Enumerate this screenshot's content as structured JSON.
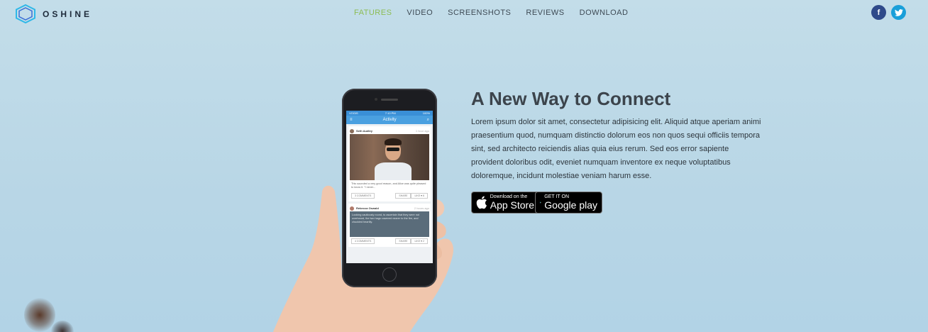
{
  "brand": {
    "name": "OSHINE",
    "accent": "#2fb8e8"
  },
  "nav": {
    "items": [
      "FATURES",
      "VIDEO",
      "SCREENSHOTS",
      "REVIEWS",
      "DOWNLOAD"
    ],
    "active_color": "#8cbc53"
  },
  "social": {
    "facebook": "f",
    "twitter": "t"
  },
  "hero": {
    "title": "A New Way to Connect",
    "description": "Lorem ipsum dolor sit amet, consectetur adipisicing elit. Aliquid atque aperiam animi praesentium quod, numquam distinctio dolorum eos non quos sequi officiis tempora sint, sed architecto reiciendis alias quia eius rerum. Sed eos error sapiente provident doloribus odit, eveniet numquam inventore ex neque voluptatibus doloremque, incidunt molestiae veniam harum esse."
  },
  "badges": {
    "appstore_small": "Download on the",
    "appstore_big": "App Store",
    "gplay_small": "GET IT ON",
    "gplay_big": "Google play"
  },
  "phone": {
    "status_left": "VOGIS",
    "status_time": "7:10 PM",
    "status_right": "100%",
    "appbar_title": "Activity",
    "post1": {
      "author": "Seth Audley",
      "time": "1 hour ago",
      "text": "This sounded a very good reason, and Alice was quite pleased to know it. \"I never...",
      "comments": "3 COMMENTS",
      "share": "SHARE",
      "like": "LIKE ♥ 6"
    },
    "post2": {
      "author": "Rebecca Oswald",
      "time": "2 hours ago",
      "text": "Looking cautiously round, to ascertain that they were not overheard, the two hags cowered nearer to the fire, and chuckled heartily.",
      "comments": "4 COMMENTS",
      "share": "SHARE",
      "like": "LIKE ♥ 2"
    }
  }
}
